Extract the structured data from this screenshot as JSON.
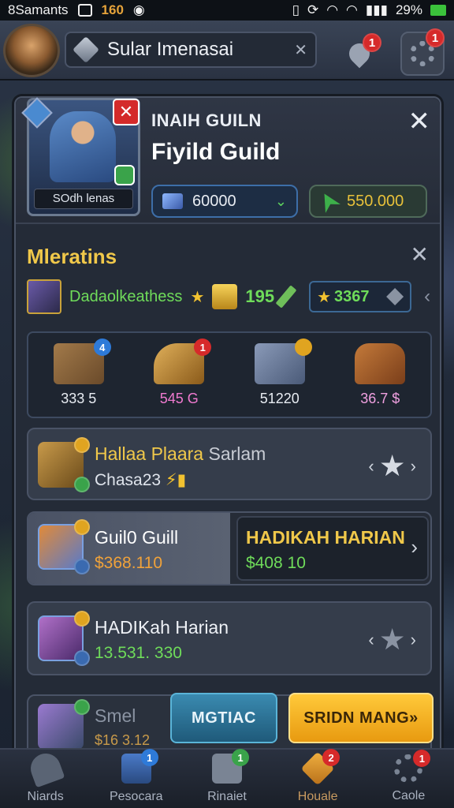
{
  "status_bar": {
    "carrier": "8Samants",
    "badge": "160",
    "battery": "29%"
  },
  "header": {
    "title": "Sular Imenasai",
    "pin_badge": "1",
    "settings_badge": "1"
  },
  "guild": {
    "subtitle": "INAIH GUILN",
    "title": "Fiyild Guild",
    "hero_name": "SOdh lenas",
    "gems_value": "60000",
    "cash_value": "550.000"
  },
  "missions": {
    "title": "Mleratins",
    "item_name": "Dadaolkeathess",
    "coin_value": "195",
    "star_value": "3367"
  },
  "rewards": [
    {
      "value": "333 5",
      "badge": "4"
    },
    {
      "value": "545 G",
      "badge": "1"
    },
    {
      "value": "51220",
      "badge": ""
    },
    {
      "value": "36.7 $",
      "badge": ""
    }
  ],
  "cards": {
    "card1": {
      "title_main": "Hallaa Plaara",
      "title_rest": "Sarlam",
      "subtitle": "Chasa23"
    },
    "card2": {
      "title": "Guil0 Guill",
      "value": "$368.110",
      "right_title": "HADIKAH HARIAN",
      "right_value": "$408 10"
    },
    "card3": {
      "title": "HADIKah Harian",
      "value": "13.531. 330"
    },
    "card4": {
      "title": "Smel",
      "value": "$16 3.12"
    }
  },
  "buttons": {
    "blue": "MGTIAC",
    "gold": "SRIDN MANG»"
  },
  "bottom_nav": [
    {
      "label": "Niards",
      "badge": ""
    },
    {
      "label": "Pesocara",
      "badge": "1"
    },
    {
      "label": "Rinaiet",
      "badge": "1"
    },
    {
      "label": "Houale",
      "badge": "2"
    },
    {
      "label": "Caole",
      "badge": "1"
    }
  ]
}
